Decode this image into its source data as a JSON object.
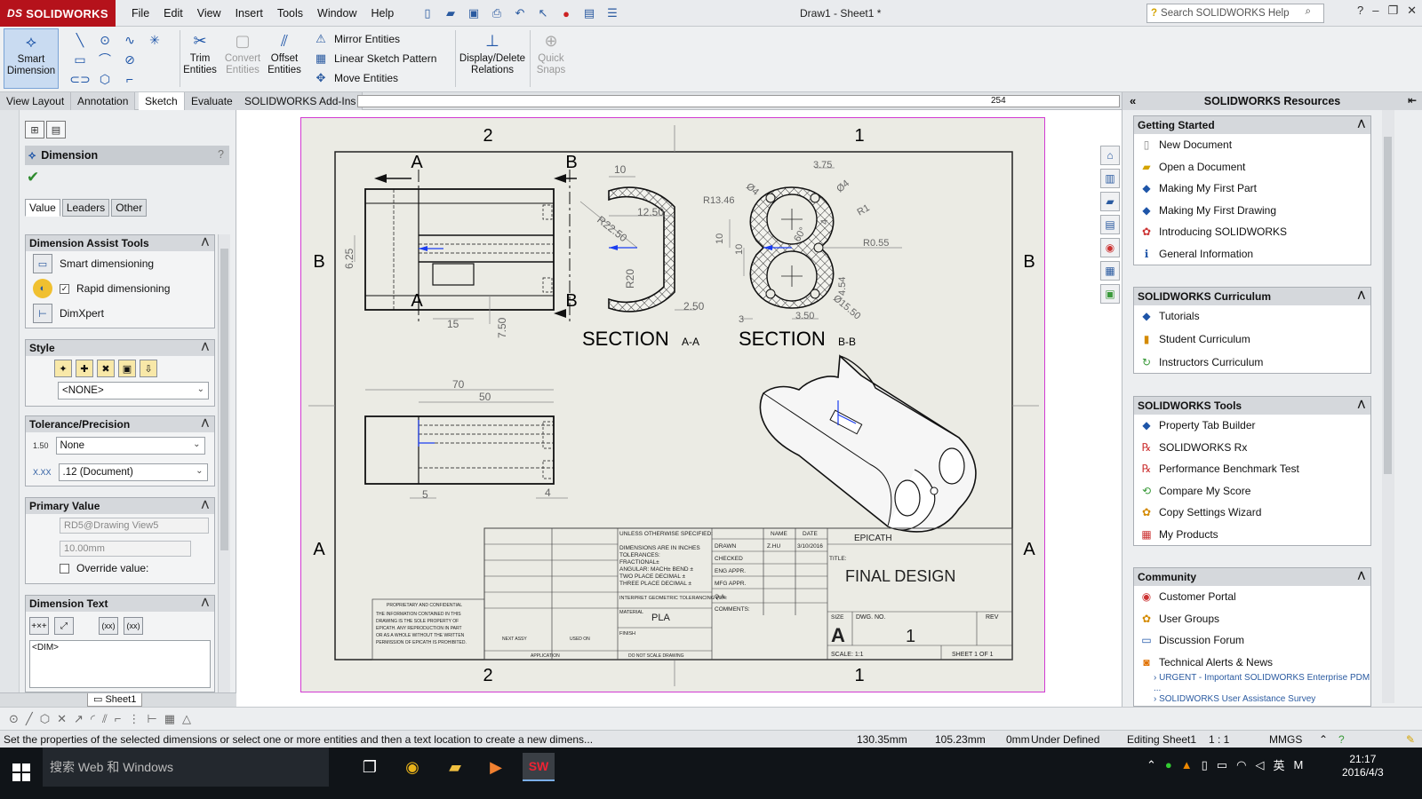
{
  "app": {
    "name": "SOLIDWORKS",
    "doc_title": "Draw1 - Sheet1 *"
  },
  "menu": [
    "File",
    "Edit",
    "View",
    "Insert",
    "Tools",
    "Window",
    "Help"
  ],
  "help_search": {
    "placeholder": "Search SOLIDWORKS Help"
  },
  "commands": {
    "smart_dimension": "Smart\nDimension",
    "trim": "Trim\nEntities",
    "convert": "Convert\nEntities",
    "offset": "Offset\nEntities",
    "mirror": "Mirror Entities",
    "linear_pattern": "Linear Sketch Pattern",
    "move": "Move Entities",
    "display_relations": "Display/Delete\nRelations",
    "quick_snaps": "Quick\nSnaps"
  },
  "tabs": [
    "View Layout",
    "Annotation",
    "Sketch",
    "Evaluate",
    "SOLIDWORKS Add-Ins"
  ],
  "active_tab": "Sketch",
  "ruler_value": "254",
  "property_manager": {
    "title": "Dimension",
    "help": "?",
    "tabs": [
      "Value",
      "Leaders",
      "Other"
    ],
    "assist": {
      "title": "Dimension Assist Tools",
      "smart": "Smart dimensioning",
      "rapid": "Rapid dimensioning",
      "dimxpert": "DimXpert"
    },
    "style": {
      "title": "Style",
      "value": "<NONE>"
    },
    "tolerance": {
      "title": "Tolerance/Precision",
      "tol_type": "None",
      "precision": ".12 (Document)"
    },
    "primary": {
      "title": "Primary Value",
      "name": "RD5@Drawing View5",
      "value": "10.00mm",
      "override": "Override value:"
    },
    "dimtext": {
      "title": "Dimension Text",
      "content": "<DIM>",
      "b1": "(xx)",
      "b2": "(xx)"
    }
  },
  "sheet_tab": "Sheet1",
  "drawing": {
    "zone_top_left": "2",
    "zone_top_right": "1",
    "zone_left_top": "B",
    "zone_left_bottom": "A",
    "zone_right_top": "B",
    "zone_right_bottom": "A",
    "zone_bottom_left": "2",
    "zone_bottom_right": "1",
    "cut_a": "A",
    "cut_b": "B",
    "section_aa": "SECTION",
    "section_aa_sub": "A-A",
    "section_bb": "SECTION",
    "section_bb_sub": "B-B",
    "dims_front": [
      "6.25",
      "15",
      "7.50"
    ],
    "dims_sec_a": [
      "10",
      "12.50",
      "R22.50",
      "R20",
      "2.50"
    ],
    "dims_sec_b": [
      "3.75",
      "Ø4",
      "Ø4",
      "R13.46",
      "R1",
      "10",
      "10",
      "60°",
      "4",
      "R0.55",
      "4.54",
      "3",
      "3.50",
      "Ø15.50"
    ],
    "dims_top": [
      "70",
      "50",
      "5",
      "4"
    ],
    "title_block": {
      "tolerance_note": "UNLESS OTHERWISE SPECIFIED:",
      "units_note": "DIMENSIONS ARE IN INCHES",
      "tol_lines": [
        "TOLERANCES:",
        "FRACTIONAL±",
        "ANGULAR: MACH±   BEND ±",
        "TWO PLACE DECIMAL    ±",
        "THREE PLACE DECIMAL  ±"
      ],
      "interpret": "INTERPRET GEOMETRIC TOLERANCING PER:",
      "material_label": "MATERIAL",
      "material": "PLA",
      "finish_label": "FINISH",
      "name_col": "NAME",
      "date_col": "DATE",
      "drawn": "DRAWN",
      "drawn_name": "Z.HU",
      "drawn_date": "3/10/2016",
      "checked": "CHECKED",
      "eng": "ENG APPR.",
      "mfg": "MFG APPR.",
      "qa": "Q.A.",
      "comments": "COMMENTS:",
      "company": "EPICATH",
      "title_label": "TITLE:",
      "title": "FINAL DESIGN",
      "size_label": "SIZE",
      "size": "A",
      "dwg_label": "DWG.  NO.",
      "dwg_no": "1",
      "rev_label": "REV",
      "scale": "SCALE: 1:1",
      "sheet": "SHEET 1 OF 1",
      "proprietary_title": "PROPRIETARY AND CONFIDENTIAL",
      "proprietary_text": [
        "THE INFORMATION CONTAINED IN THIS",
        "DRAWING IS THE SOLE PROPERTY OF",
        "EPICATH.  ANY REPRODUCTION IN PART",
        "OR AS A  WHOLE WITHOUT THE WRITTEN",
        "PERMISSION OF EPICATH IS PROHIBITED."
      ],
      "next_assy": "NEXT ASSY",
      "used_on": "USED ON",
      "application": "APPLICATION",
      "do_not_scale": "DO NOT SCALE DRAWING"
    }
  },
  "resources": {
    "title": "SOLIDWORKS Resources",
    "getting_started": {
      "title": "Getting Started",
      "items": [
        "New Document",
        "Open a Document",
        "Making My First Part",
        "Making My First Drawing",
        "Introducing SOLIDWORKS",
        "General Information"
      ]
    },
    "curriculum": {
      "title": "SOLIDWORKS Curriculum",
      "items": [
        "Tutorials",
        "Student Curriculum",
        "Instructors Curriculum"
      ]
    },
    "tools": {
      "title": "SOLIDWORKS Tools",
      "items": [
        "Property Tab Builder",
        "SOLIDWORKS Rx",
        "Performance Benchmark Test",
        "Compare My Score",
        "Copy Settings Wizard",
        "My Products"
      ]
    },
    "community": {
      "title": "Community",
      "items": [
        "Customer Portal",
        "User Groups",
        "Discussion Forum",
        "Technical Alerts & News"
      ],
      "links": [
        "URGENT - Important SOLIDWORKS Enterprise PDM ...",
        "SOLIDWORKS User Assistance Survey"
      ]
    }
  },
  "status": {
    "message": "Set the properties of the selected dimensions or select one or more entities and then a text location to create a new dimens...",
    "x": "130.35mm",
    "y": "105.23mm",
    "z": "0mm",
    "state": "Under Defined",
    "editing": "Editing Sheet1",
    "scale": "1 : 1",
    "units": "MMGS"
  },
  "taskbar": {
    "search": "搜索 Web 和 Windows",
    "ime": "英",
    "time": "21:17",
    "date": "2016/4/3"
  },
  "colors": {
    "brand": "#b5121b",
    "sheet": "#ebebe4",
    "sheet_border": "#d23ad2",
    "accent": "#1e55a8"
  }
}
